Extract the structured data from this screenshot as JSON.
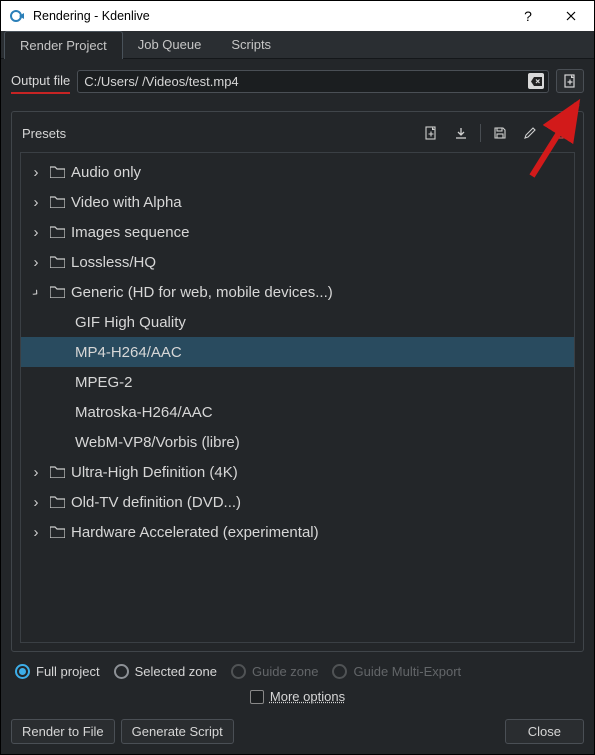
{
  "window": {
    "title": "Rendering - Kdenlive"
  },
  "tabs": {
    "t0": "Render Project",
    "t1": "Job Queue",
    "t2": "Scripts"
  },
  "output": {
    "label": "Output file",
    "path_prefix": "C:/Users/",
    "path_masked": "        ",
    "path_suffix": "/Videos/test.mp4",
    "clear_glyph": "⌫",
    "browse_name": "file-dialog-icon"
  },
  "presets": {
    "label": "Presets",
    "toolbar_icons": {
      "new_doc": "new-preset-icon",
      "download": "download-preset-icon",
      "save": "save-preset-icon",
      "edit": "edit-preset-icon",
      "delete": "delete-preset-icon"
    },
    "folders": {
      "f0": "Audio only",
      "f1": "Video with Alpha",
      "f2": "Images sequence",
      "f3": "Lossless/HQ",
      "f4": "Generic (HD for web, mobile devices...)",
      "f5": "Ultra-High Definition (4K)",
      "f6": "Old-TV definition (DVD...)",
      "f7": "Hardware Accelerated (experimental)"
    },
    "generic_children": {
      "c0": "GIF High Quality",
      "c1": "MP4-H264/AAC",
      "c2": "MPEG-2",
      "c3": "Matroska-H264/AAC",
      "c4": "WebM-VP8/Vorbis (libre)"
    }
  },
  "range": {
    "full": "Full project",
    "zone": "Selected zone",
    "guide": "Guide zone",
    "multi": "Guide Multi-Export"
  },
  "more_options": "More options",
  "buttons": {
    "render": "Render to File",
    "script": "Generate Script",
    "close": "Close"
  }
}
